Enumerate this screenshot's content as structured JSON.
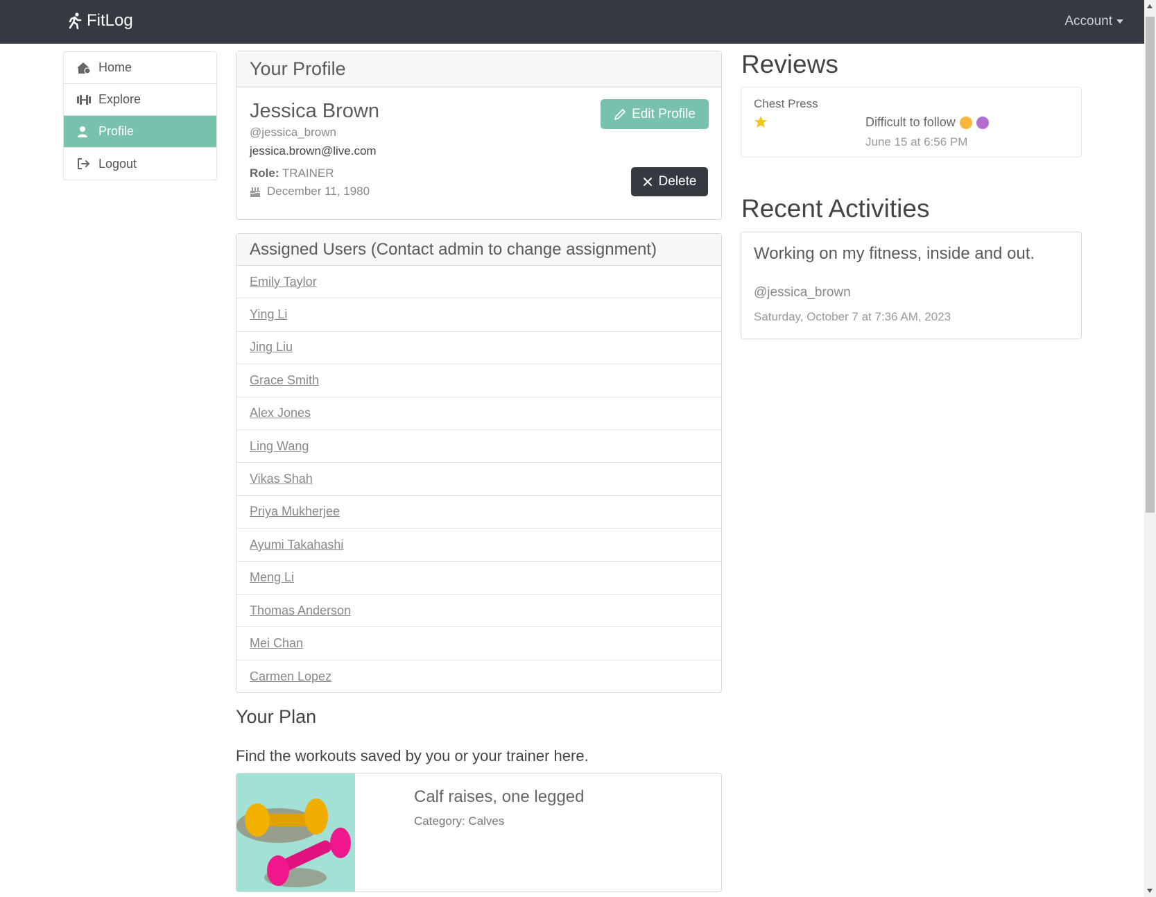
{
  "app": {
    "brand": "FitLog",
    "account_label": "Account"
  },
  "sidebar": {
    "items": [
      {
        "label": "Home",
        "icon": "home-icon"
      },
      {
        "label": "Explore",
        "icon": "dumbbell-icon"
      },
      {
        "label": "Profile",
        "icon": "user-icon",
        "active": true
      },
      {
        "label": "Logout",
        "icon": "logout-icon"
      }
    ]
  },
  "profile": {
    "header": "Your Profile",
    "name": "Jessica Brown",
    "username": "@jessica_brown",
    "email": "jessica.brown@live.com",
    "role_label": "Role:",
    "role": "TRAINER",
    "birthday": "December 11, 1980",
    "edit_label": "Edit Profile",
    "delete_label": "Delete"
  },
  "assigned": {
    "header": "Assigned Users (Contact admin to change assignment)",
    "users": [
      "Emily Taylor",
      "Ying Li",
      "Jing Liu",
      "Grace Smith",
      "Alex Jones",
      "Ling Wang",
      "Vikas Shah",
      "Priya Mukherjee",
      "Ayumi Takahashi",
      "Meng Li",
      "Thomas Anderson",
      "Mei Chan",
      "Carmen Lopez"
    ]
  },
  "plan": {
    "title": "Your Plan",
    "subtitle": "Find the workouts saved by you or your trainer here.",
    "workout_name": "Calf raises, one legged",
    "workout_category": "Category: Calves"
  },
  "reviews": {
    "title": "Reviews",
    "items": [
      {
        "exercise": "Chest Press",
        "rating": 1,
        "text": "Difficult to follow",
        "date": "June 15 at 6:56 PM"
      }
    ]
  },
  "activities": {
    "title": "Recent Activities",
    "items": [
      {
        "text": "Working on my fitness, inside and out.",
        "user": "@jessica_brown",
        "date": "Saturday, October 7 at 7:36 AM, 2023"
      }
    ]
  },
  "colors": {
    "accent": "#78c2ad",
    "navbar": "#343a40",
    "dark_button": "#343a40"
  }
}
